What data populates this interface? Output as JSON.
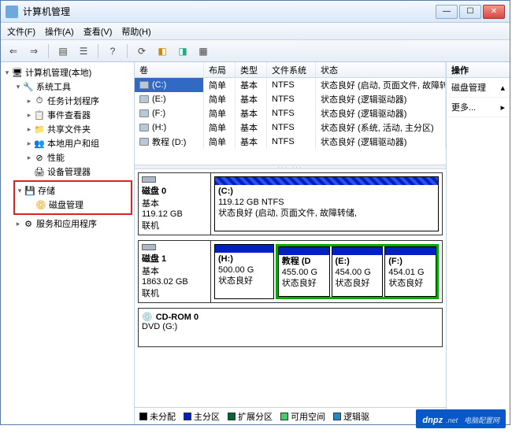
{
  "window": {
    "title": "计算机管理"
  },
  "menu": {
    "file": "文件(F)",
    "action": "操作(A)",
    "view": "查看(V)",
    "help": "帮助(H)"
  },
  "tree": {
    "root": "计算机管理(本地)",
    "system_tools": "系统工具",
    "task_scheduler": "任务计划程序",
    "event_viewer": "事件查看器",
    "shared_folders": "共享文件夹",
    "local_users": "本地用户和组",
    "performance": "性能",
    "device_mgr": "设备管理器",
    "storage": "存储",
    "disk_mgmt": "磁盘管理",
    "services_apps": "服务和应用程序"
  },
  "volumes": {
    "headers": {
      "vol": "卷",
      "layout": "布局",
      "type": "类型",
      "fs": "文件系统",
      "status": "状态"
    },
    "rows": [
      {
        "vol": "(C:)",
        "layout": "简单",
        "type": "基本",
        "fs": "NTFS",
        "status": "状态良好 (启动, 页面文件, 故障转储",
        "selected": true
      },
      {
        "vol": "(E:)",
        "layout": "简单",
        "type": "基本",
        "fs": "NTFS",
        "status": "状态良好 (逻辑驱动器)"
      },
      {
        "vol": "(F:)",
        "layout": "简单",
        "type": "基本",
        "fs": "NTFS",
        "status": "状态良好 (逻辑驱动器)"
      },
      {
        "vol": "(H:)",
        "layout": "简单",
        "type": "基本",
        "fs": "NTFS",
        "status": "状态良好 (系统, 活动, 主分区)"
      },
      {
        "vol": "教程 (D:)",
        "layout": "简单",
        "type": "基本",
        "fs": "NTFS",
        "status": "状态良好 (逻辑驱动器)"
      }
    ]
  },
  "disks": {
    "d0": {
      "name": "磁盘 0",
      "type": "基本",
      "size": "119.12 GB",
      "status": "联机",
      "parts": [
        {
          "label": "(C:)",
          "size": "119.12 GB NTFS",
          "status": "状态良好 (启动, 页面文件, 故障转储,"
        }
      ]
    },
    "d1": {
      "name": "磁盘 1",
      "type": "基本",
      "size": "1863.02 GB",
      "status": "联机",
      "parts": [
        {
          "label": "(H:)",
          "size": "500.00 G",
          "status": "状态良好"
        },
        {
          "label": "教程 (D",
          "size": "455.00 G",
          "status": "状态良好"
        },
        {
          "label": "(E:)",
          "size": "454.00 G",
          "status": "状态良好"
        },
        {
          "label": "(F:)",
          "size": "454.01 G",
          "status": "状态良好"
        }
      ]
    },
    "cd": {
      "name": "CD-ROM 0",
      "type": "DVD (G:)"
    }
  },
  "legend": {
    "unalloc": "未分配",
    "primary": "主分区",
    "extended": "扩展分区",
    "free": "可用空间",
    "logical": "逻辑驱"
  },
  "actions": {
    "header": "操作",
    "item": "磁盘管理",
    "more": "更多..."
  },
  "watermark": {
    "main": "dnpz",
    "sub": ".net",
    "tag": "电脑配置网"
  }
}
